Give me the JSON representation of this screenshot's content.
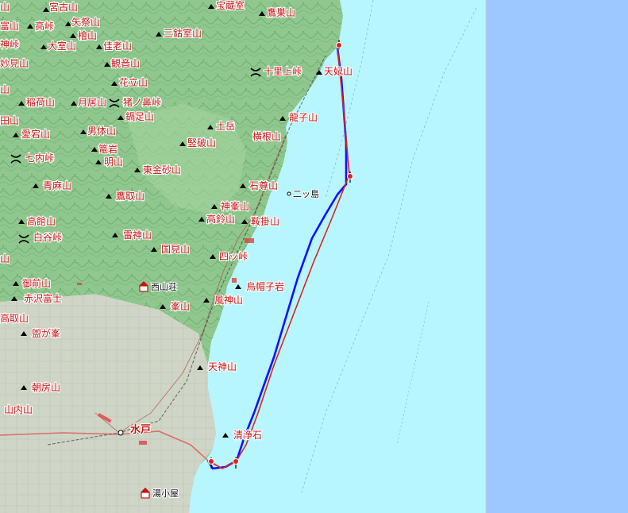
{
  "colors": {
    "ocean": "#b8f6ff",
    "frame": "#9cc7ff",
    "land": "#8fc78f",
    "land_dark": "#6faf6c",
    "lowland": "#d7d9cc",
    "label": "#c81414",
    "route_blue": "#1010ff",
    "route_red": "#e02020"
  },
  "labels": [
    {
      "id": "shigaku",
      "text": "宮古山"
    },
    {
      "id": "takahoko",
      "text": "高峠"
    },
    {
      "id": "yasaka",
      "text": "矢祭山"
    },
    {
      "id": "hinoki",
      "text": "檜山"
    },
    {
      "id": "homuro",
      "text": "宝蔵室"
    },
    {
      "id": "takahigashi",
      "text": "鷹巣山"
    },
    {
      "id": "taimuro",
      "text": "大室山"
    },
    {
      "id": "kasuga",
      "text": "佳老山"
    },
    {
      "id": "sangotsu",
      "text": "三鈷室山"
    },
    {
      "id": "kannon",
      "text": "観音山"
    },
    {
      "id": "myoken",
      "text": "妙見山"
    },
    {
      "id": "hanadate",
      "text": "花立山"
    },
    {
      "id": "senri",
      "text": "十里上峠"
    },
    {
      "id": "tenkan",
      "text": "天妃山"
    },
    {
      "id": "inari",
      "text": "稲荷山"
    },
    {
      "id": "tsukio",
      "text": "月居山"
    },
    {
      "id": "sarunohana",
      "text": "猪ノ鼻峠"
    },
    {
      "id": "nabe",
      "text": "鍋足山"
    },
    {
      "id": "tagata",
      "text": "田山"
    },
    {
      "id": "atago",
      "text": "愛宕山"
    },
    {
      "id": "nantai",
      "text": "男体山"
    },
    {
      "id": "tsuchi",
      "text": "土岳"
    },
    {
      "id": "ryushi",
      "text": "龍子山"
    },
    {
      "id": "take",
      "text": "篭岩"
    },
    {
      "id": "kenpa",
      "text": "竪破山"
    },
    {
      "id": "yokone",
      "text": "横根山"
    },
    {
      "id": "nanauchi",
      "text": "七内峠"
    },
    {
      "id": "akiyama",
      "text": "明山"
    },
    {
      "id": "higashikane",
      "text": "東金砂山"
    },
    {
      "id": "seiran",
      "text": "青麻山"
    },
    {
      "id": "ishison",
      "text": "石尊山"
    },
    {
      "id": "futatsu",
      "text": "二ッ島"
    },
    {
      "id": "taka_tori",
      "text": "鷹取山"
    },
    {
      "id": "kamine",
      "text": "神峯山"
    },
    {
      "id": "takadate",
      "text": "高館山"
    },
    {
      "id": "takasuzu",
      "text": "高鈴山"
    },
    {
      "id": "kurakake",
      "text": "鞍掛山"
    },
    {
      "id": "shiraya",
      "text": "白谷峠"
    },
    {
      "id": "raijin",
      "text": "雷神山"
    },
    {
      "id": "kunimi",
      "text": "国見山"
    },
    {
      "id": "yotsu",
      "text": "四ッ峠"
    },
    {
      "id": "gozen",
      "text": "御前山"
    },
    {
      "id": "nishiyama",
      "text": "西山荘"
    },
    {
      "id": "eboshi",
      "text": "烏帽子岩"
    },
    {
      "id": "akazawa",
      "text": "赤沢富士"
    },
    {
      "id": "fujin",
      "text": "風神山"
    },
    {
      "id": "mine",
      "text": "峯山"
    },
    {
      "id": "takatori2",
      "text": "高取山"
    },
    {
      "id": "bangamine",
      "text": "盥が峯"
    },
    {
      "id": "tenjin",
      "text": "天神山"
    },
    {
      "id": "asabo",
      "text": "朝房山"
    },
    {
      "id": "sannai",
      "text": "山内山"
    },
    {
      "id": "mito",
      "text": "水戸"
    },
    {
      "id": "seijyo",
      "text": "清浄石"
    },
    {
      "id": "yunokoya",
      "text": "湯小屋"
    },
    {
      "id": "e1",
      "text": "張山"
    },
    {
      "id": "e2",
      "text": "山"
    },
    {
      "id": "e3",
      "text": "富山"
    },
    {
      "id": "e4",
      "text": "神峠"
    },
    {
      "id": "e5",
      "text": "山"
    },
    {
      "id": "e6",
      "text": "山"
    }
  ]
}
